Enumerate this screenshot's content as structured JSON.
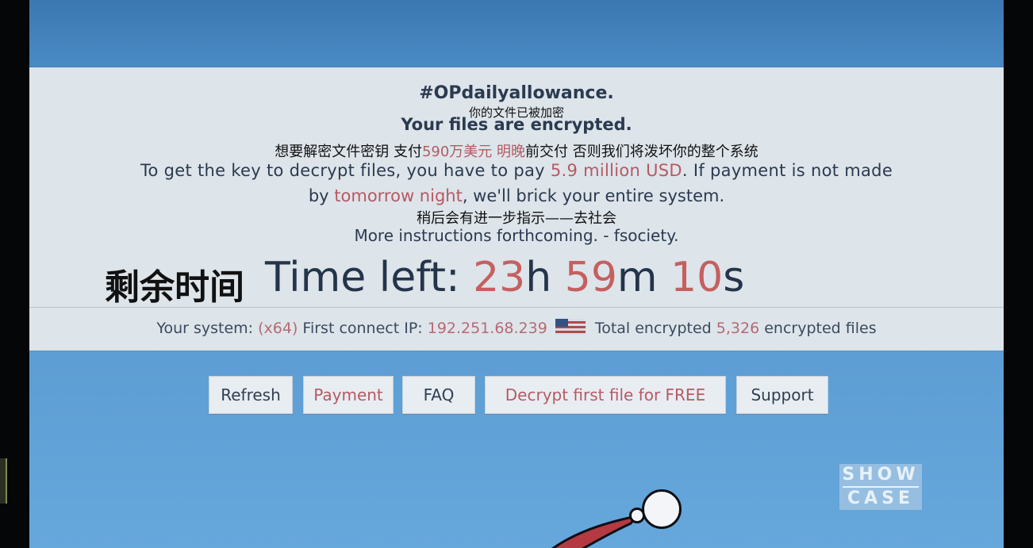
{
  "ransom": {
    "hashtag": "#OPdailyallowance.",
    "subtitle_cn_1": "你的文件已被加密",
    "encrypted_title": "Your files are encrypted.",
    "subtitle_cn_2_a": "想要解密文件密钥  支付",
    "subtitle_cn_2_amount": "590万美元",
    "subtitle_cn_2_b": "  ",
    "subtitle_cn_2_deadline": "明晚",
    "subtitle_cn_2_c": "前交付  否则我们将泼坏你的整个系统",
    "line1_a": "To get the key to decrypt files, you have to pay ",
    "line1_amount": "5.9 million USD",
    "line1_b": ". If payment is not made",
    "line2_a": "by ",
    "line2_deadline": "tomorrow night",
    "line2_b": ", we'll brick your entire system.",
    "subtitle_cn_3": "稍后会有进一步指示——去社会",
    "line3": "More instructions forthcoming. - fsociety."
  },
  "timer": {
    "label_cn": "剩余时间",
    "label": "Time left: ",
    "hours": "23",
    "hours_unit": "h ",
    "minutes": "59",
    "minutes_unit": "m ",
    "seconds": "10",
    "seconds_unit": "s"
  },
  "info": {
    "system_label": "Your system: ",
    "system_value": "(x64)",
    "ip_label": "  First connect IP: ",
    "ip_value": "192.251.68.239",
    "total_label": "Total encrypted ",
    "total_value": "5,326",
    "total_suffix": " encrypted files",
    "flag_icon": "us-flag-icon"
  },
  "buttons": {
    "refresh": "Refresh",
    "payment": "Payment",
    "faq": "FAQ",
    "decrypt": "Decrypt first file for FREE",
    "support": "Support"
  },
  "watermark": {
    "line1": "SHOW",
    "line2": "CASE"
  },
  "colors": {
    "accent_red": "#b65a63",
    "navy_text": "#2b3a4f",
    "panel_bg": "#dde4ea",
    "page_blue": "#5a9bd1"
  }
}
